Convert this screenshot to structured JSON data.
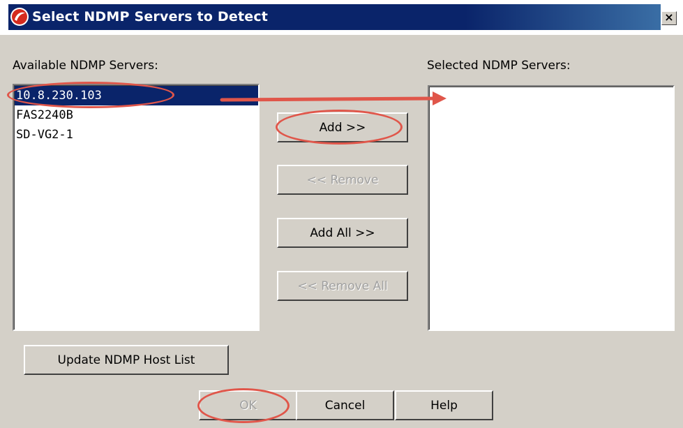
{
  "dialog": {
    "title": "Select NDMP Servers to Detect",
    "close_label": "×"
  },
  "available": {
    "label": "Available NDMP Servers:",
    "items": [
      "10.8.230.103",
      "FAS2240B",
      "SD-VG2-1"
    ],
    "selected_index": 0
  },
  "selected": {
    "label": "Selected NDMP Servers:",
    "items": []
  },
  "buttons": {
    "add": "Add >>",
    "remove": "<< Remove",
    "add_all": "Add All >>",
    "remove_all": "<< Remove All",
    "update": "Update NDMP Host List",
    "ok": "OK",
    "cancel": "Cancel",
    "help": "Help"
  },
  "button_states": {
    "remove_enabled": false,
    "remove_all_enabled": false,
    "ok_enabled": false
  },
  "colors": {
    "annotation": "#e0564a",
    "selection": "#0a246a",
    "title_bar": "#0a246a"
  }
}
